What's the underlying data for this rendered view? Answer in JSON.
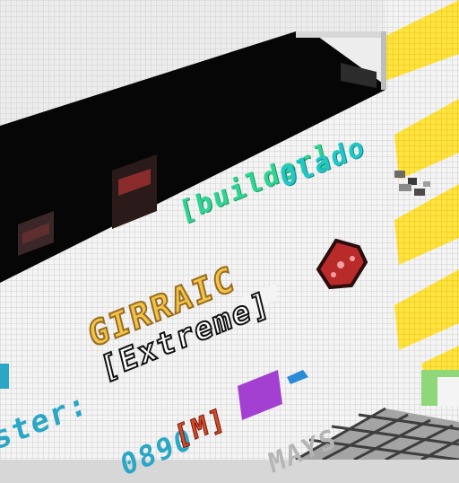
{
  "scene": {
    "colors": {
      "wall_light": "#f3f3f3",
      "wall_shade": "#dcdcdc",
      "roof": "#e6e6e6",
      "interior_dark": "#050505",
      "yellow_floor": "#ffe23b",
      "yellow_alt": "#ffd21a",
      "grid_floor": "#9a9a9a",
      "grid_line": "#343434",
      "green_block": "#7ed06b"
    },
    "signs": {
      "builder": "[builder]",
      "name": "Olado",
      "brand": "GIRRAIC",
      "mode": "[Extreme]",
      "partial_left": "ster:",
      "code": "0890",
      "rank": "[M]",
      "bottom": "MAYS"
    },
    "icons": {
      "meat": "raw-meat-icon",
      "bookshelf": "bookshelf-icon",
      "figures": "creature-figures-icon"
    }
  }
}
